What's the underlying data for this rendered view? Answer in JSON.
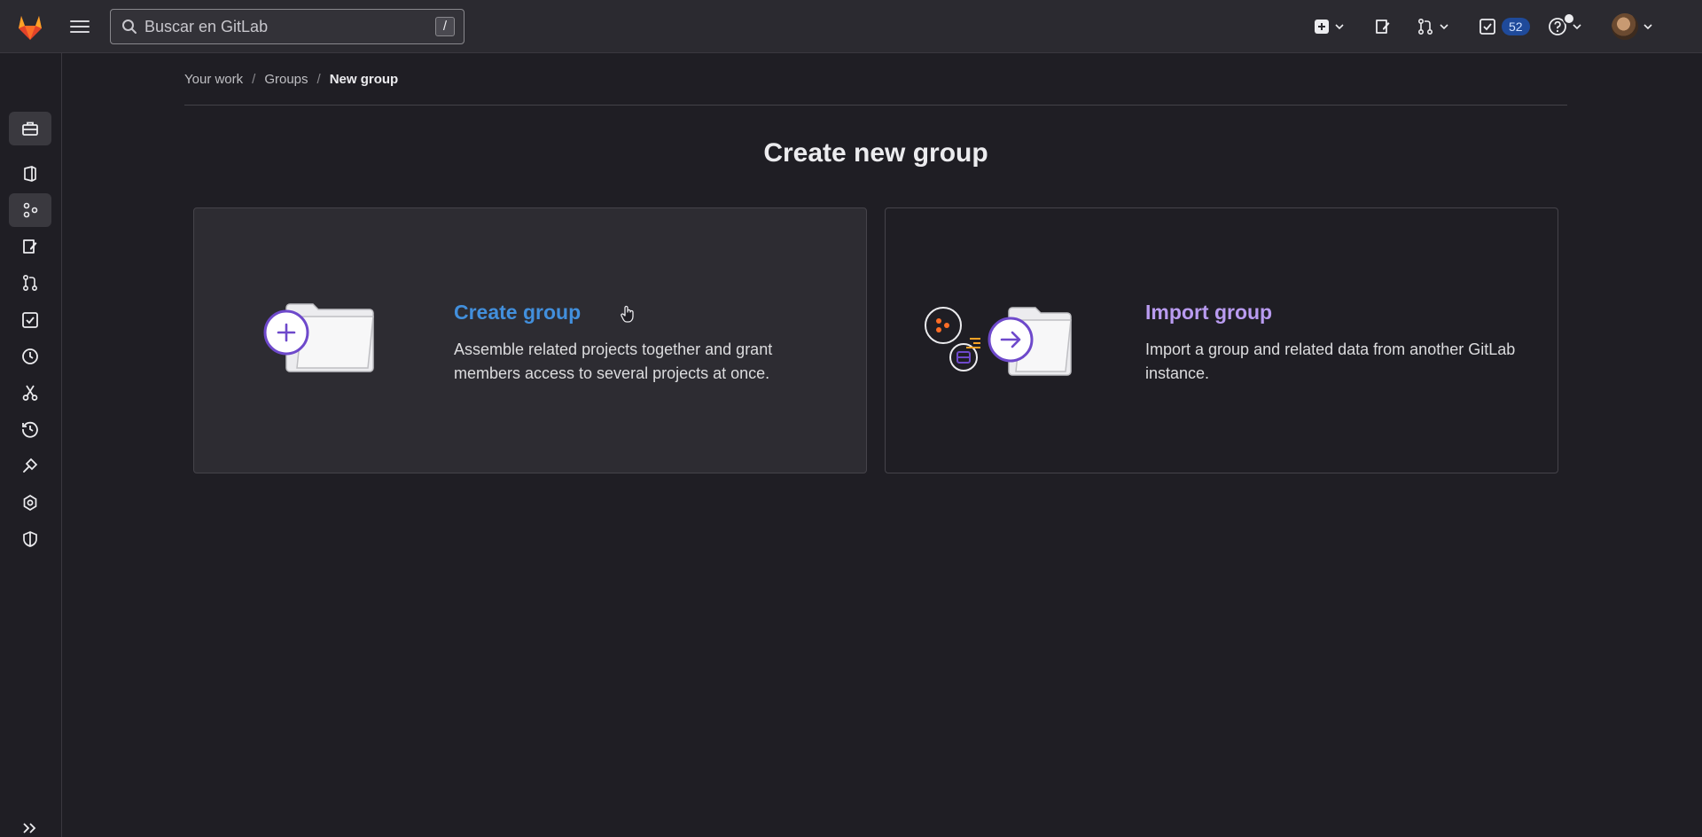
{
  "search": {
    "placeholder": "Buscar en GitLab",
    "shortcut": "/"
  },
  "topbar": {
    "todos_count": "52"
  },
  "breadcrumb": {
    "items": [
      "Your work",
      "Groups",
      "New group"
    ]
  },
  "page": {
    "title": "Create new group"
  },
  "cards": [
    {
      "title": "Create group",
      "description": "Assemble related projects together and grant members access to several projects at once.",
      "title_color": "#428fdc"
    },
    {
      "title": "Import group",
      "description": "Import a group and related data from another GitLab instance.",
      "title_color": "#b99bf0"
    }
  ],
  "colors": {
    "background": "#1f1e24",
    "topbar": "#2b2a30",
    "accent_purple": "#6e49cb",
    "logo_orange": "#e24329"
  }
}
